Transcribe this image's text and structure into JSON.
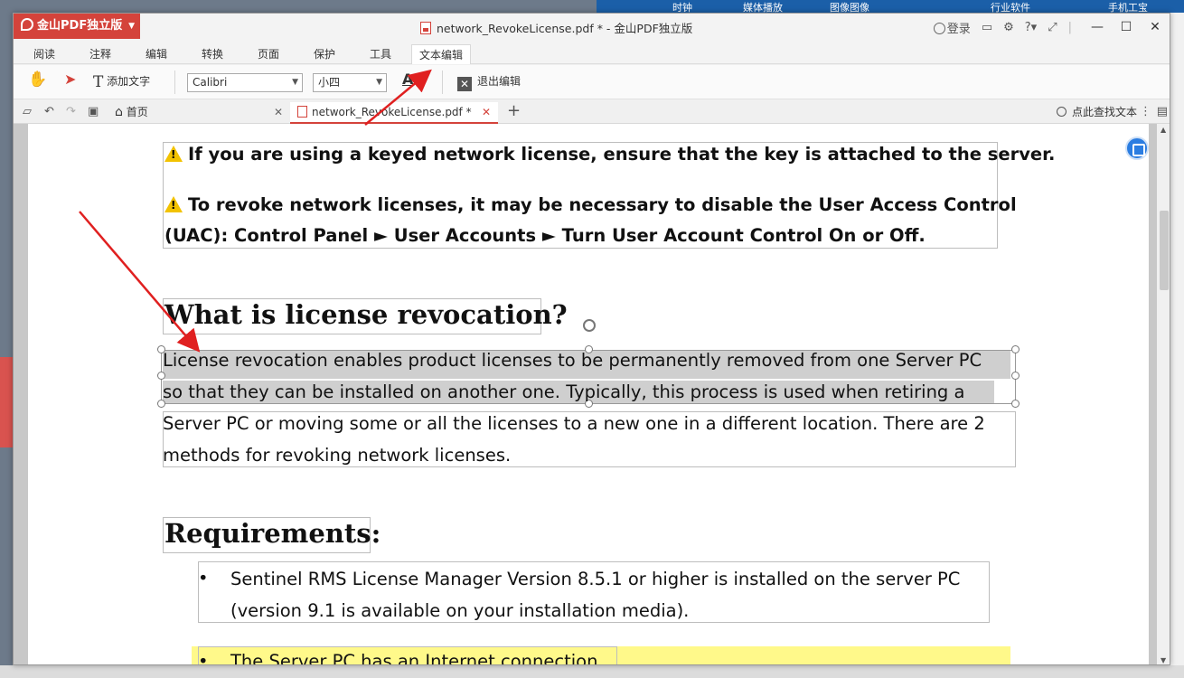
{
  "background": {
    "top_items": [
      "时钟",
      "媒体播放",
      "图像图像",
      "行业软件",
      "手机工宝"
    ]
  },
  "titlebar": {
    "app_name": "金山PDF独立版",
    "window_title": "network_RevokeLicense.pdf * - 金山PDF独立版",
    "login": "登录",
    "help": "?"
  },
  "menu": {
    "tabs": [
      "阅读",
      "注释",
      "编辑",
      "转换",
      "页面",
      "保护",
      "工具",
      "文本编辑"
    ],
    "active_tab": "文本编辑"
  },
  "toolbar": {
    "add_text": "添加文字",
    "font_family": "Calibri",
    "font_size": "小四",
    "font_color_glyph": "A",
    "exit_edit": "退出编辑"
  },
  "tabs": {
    "home": "首页",
    "document": "network_RevokeLicense.pdf *",
    "find_text": "点此查找文本"
  },
  "document": {
    "warning1": "If you are using a keyed network license, ensure that the key is attached to the server.",
    "warning2_line1": "To revoke network licenses, it may be necessary to disable the User Access Control",
    "warning2_line2": "(UAC): Control Panel ► User Accounts ► Turn User Account Control On or Off.",
    "heading1": "What is license revocation?",
    "para1_line1": "License revocation enables product licenses to be permanently removed from one Server PC",
    "para1_line2": "so that they can be installed on another one. Typically, this process is used when retiring a",
    "para1_line3": "Server PC or moving some or all the licenses to a new one in a different location. There are 2",
    "para1_line4": "methods for revoking network licenses.",
    "heading2": "Requirements:",
    "req1_line1": "Sentinel RMS License Manager Version 8.5.1 or higher is installed on the server PC",
    "req1_line2": "(version 9.1 is available on your installation media).",
    "req2": "The Server PC has an Internet connection."
  },
  "colors": {
    "accent": "#d4433b",
    "highlight": "#fff98a",
    "selection": "#cfcfcf",
    "arrow": "#e02020"
  }
}
